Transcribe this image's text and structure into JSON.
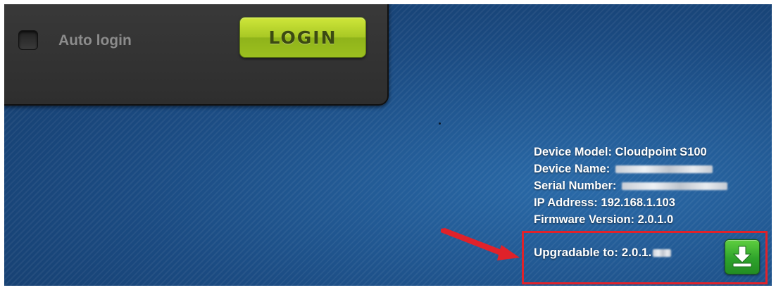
{
  "login_panel": {
    "auto_login_label": "Auto login",
    "login_button_label": "LOGIN"
  },
  "device_info": {
    "model_label": "Device Model:",
    "model_value": "Cloudpoint S100",
    "name_label": "Device Name:",
    "serial_label": "Serial Number:",
    "ip_label": "IP Address:",
    "ip_value": "192.168.1.103",
    "firmware_label": "Firmware Version:",
    "firmware_value": "2.0.1.0"
  },
  "upgrade": {
    "label": "Upgradable to:",
    "version_prefix": "2.0.1.",
    "download_icon": "download-icon"
  },
  "colors": {
    "background": "#1d4f86",
    "panel": "#333333",
    "login_button": "#a8c824",
    "highlight": "#e0222a",
    "download_button": "#2ea32b"
  }
}
